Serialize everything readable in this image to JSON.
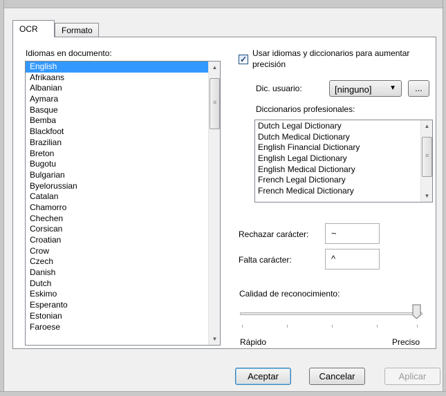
{
  "tabs": [
    {
      "label": "OCR",
      "active": true
    },
    {
      "label": "Formato",
      "active": false
    }
  ],
  "languages": {
    "label": "Idiomas en documento:",
    "selected": "English",
    "items": [
      "English",
      "Afrikaans",
      "Albanian",
      "Aymara",
      "Basque",
      "Bemba",
      "Blackfoot",
      "Brazilian",
      "Breton",
      "Bugotu",
      "Bulgarian",
      "Byelorussian",
      "Catalan",
      "Chamorro",
      "Chechen",
      "Corsican",
      "Croatian",
      "Crow",
      "Czech",
      "Danish",
      "Dutch",
      "Eskimo",
      "Esperanto",
      "Estonian",
      "Faroese"
    ]
  },
  "use_dictionaries": {
    "checked": true,
    "label_line1": "Usar idiomas y diccionarios para aumentar",
    "label_line2": "precisión"
  },
  "user_dict": {
    "label": "Dic. usuario:",
    "value": "[ninguno]",
    "browse_label": "..."
  },
  "pro_dicts": {
    "label": "Diccionarios profesionales:",
    "items": [
      "Dutch Legal Dictionary",
      "Dutch Medical Dictionary",
      "English Financial Dictionary",
      "English Legal Dictionary",
      "English Medical Dictionary",
      "French Legal Dictionary",
      "French Medical Dictionary"
    ]
  },
  "reject_char": {
    "label": "Rechazar carácter:",
    "value": "~"
  },
  "missing_char": {
    "label": "Falta carácter:",
    "value": "^"
  },
  "quality": {
    "label": "Calidad de reconocimiento:",
    "min_label": "Rápido",
    "max_label": "Preciso",
    "level": 1.0
  },
  "footer": {
    "accept": "Aceptar",
    "cancel": "Cancelar",
    "apply": "Aplicar"
  }
}
